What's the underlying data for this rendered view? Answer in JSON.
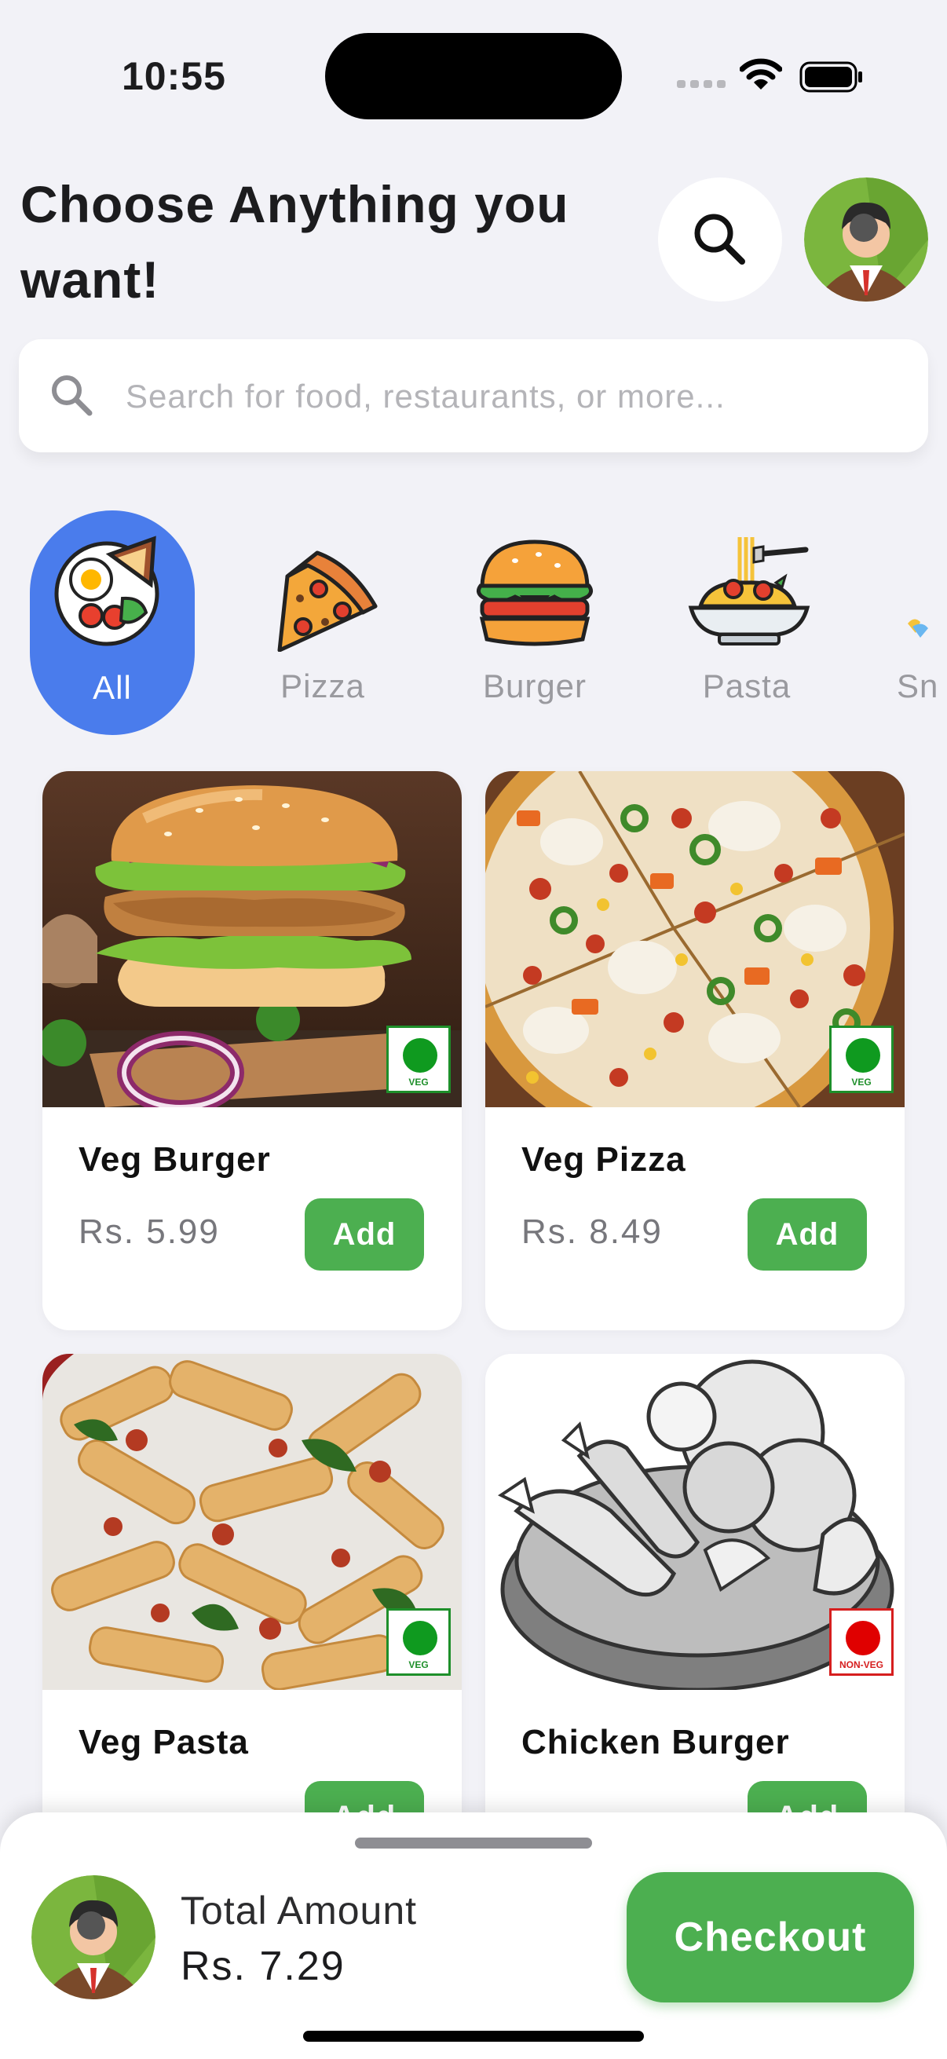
{
  "status_bar": {
    "time": "10:55"
  },
  "header": {
    "title": "Choose Anything you want!"
  },
  "search": {
    "placeholder": "Search for food, restaurants, or more..."
  },
  "categories": [
    {
      "label": "All",
      "icon": "plate-icon",
      "active": true
    },
    {
      "label": "Pizza",
      "icon": "pizza-icon",
      "active": false
    },
    {
      "label": "Burger",
      "icon": "burger-icon",
      "active": false
    },
    {
      "label": "Pasta",
      "icon": "pasta-icon",
      "active": false
    },
    {
      "label": "Sn",
      "icon": "snacks-icon",
      "active": false
    }
  ],
  "products": [
    {
      "name": "Veg Burger",
      "price": "Rs. 5.99",
      "add_label": "Add",
      "diet": "VEG"
    },
    {
      "name": "Veg Pizza",
      "price": "Rs. 8.49",
      "add_label": "Add",
      "diet": "VEG"
    },
    {
      "name": "Veg Pasta",
      "price": "",
      "add_label": "Add",
      "diet": "VEG"
    },
    {
      "name": "Chicken Burger",
      "price": "",
      "add_label": "Add",
      "diet": "NON-VEG"
    }
  ],
  "cart": {
    "total_label": "Total Amount",
    "total_value": "Rs. 7.29",
    "checkout_label": "Checkout"
  },
  "colors": {
    "accent_blue": "#4a7cec",
    "accent_green": "#4caf50",
    "veg_green": "#0f9a1f",
    "nonveg_red": "#e00000"
  }
}
